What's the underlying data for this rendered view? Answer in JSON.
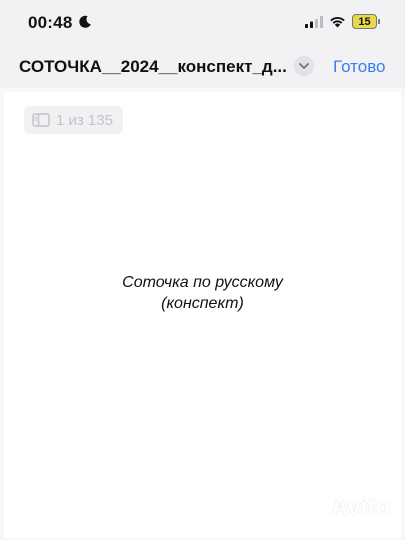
{
  "status_bar": {
    "time": "00:48",
    "battery_level": "15",
    "icons": [
      "moon-icon",
      "cellular-signal-icon",
      "wifi-icon",
      "battery-icon"
    ]
  },
  "nav_bar": {
    "title": "СОТОЧКА__2024__конспект_д...",
    "done_label": "Готово",
    "accent_color": "#3a7cf2",
    "icons": [
      "chevron-down-icon"
    ]
  },
  "viewer": {
    "page_indicator": "1 из 135",
    "page_line_1": "Соточка по русскому",
    "page_line_2": "(конспект)",
    "icons": [
      "sidebar-icon"
    ]
  },
  "watermark": {
    "text": "Avito"
  }
}
